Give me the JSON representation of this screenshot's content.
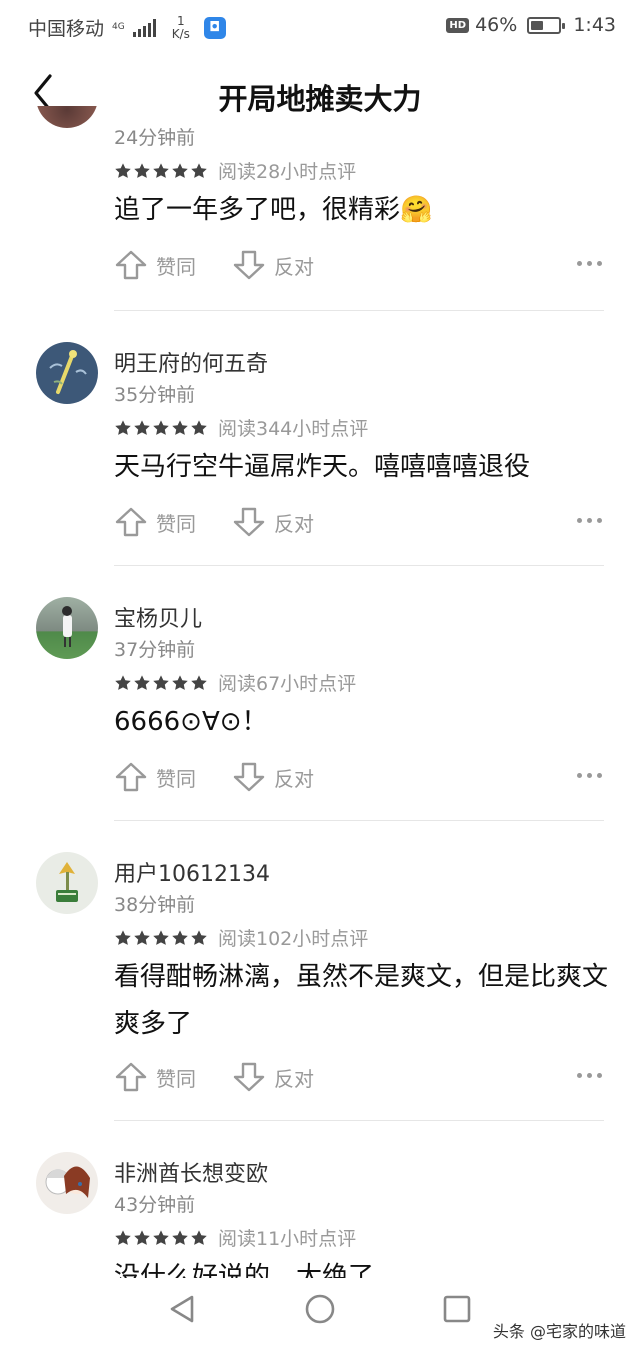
{
  "status_bar": {
    "carrier": "中国移动",
    "network": "4G",
    "speed_value": "1",
    "speed_unit": "K/s",
    "battery": "46%",
    "battery_level": 0.46,
    "time": "1:43"
  },
  "header": {
    "title": "开局地摊卖大力"
  },
  "rating_stars": 5,
  "actions": {
    "like_label": "赞同",
    "dislike_label": "反对"
  },
  "comments": [
    {
      "time": "24分钟前",
      "meta": "阅读28小时点评",
      "text": "追了一年多了吧，很精彩🤗"
    },
    {
      "name": "明王府的何五奇",
      "time": "35分钟前",
      "meta": "阅读344小时点评",
      "text": "天马行空牛逼屌炸天。嘻嘻嘻嘻退役"
    },
    {
      "name": "宝杨贝儿",
      "time": "37分钟前",
      "meta": "阅读67小时点评",
      "text": "6666⊙∀⊙！"
    },
    {
      "name": "用户10612134",
      "time": "38分钟前",
      "meta": "阅读102小时点评",
      "text": "看得酣畅淋漓，虽然不是爽文，但是比爽文爽多了"
    },
    {
      "name": "非洲酋长想变欧",
      "time": "43分钟前",
      "meta": "阅读11小时点评",
      "text": "没什么好说的，太绝了"
    }
  ],
  "watermark": "头条 @宅家的味道"
}
